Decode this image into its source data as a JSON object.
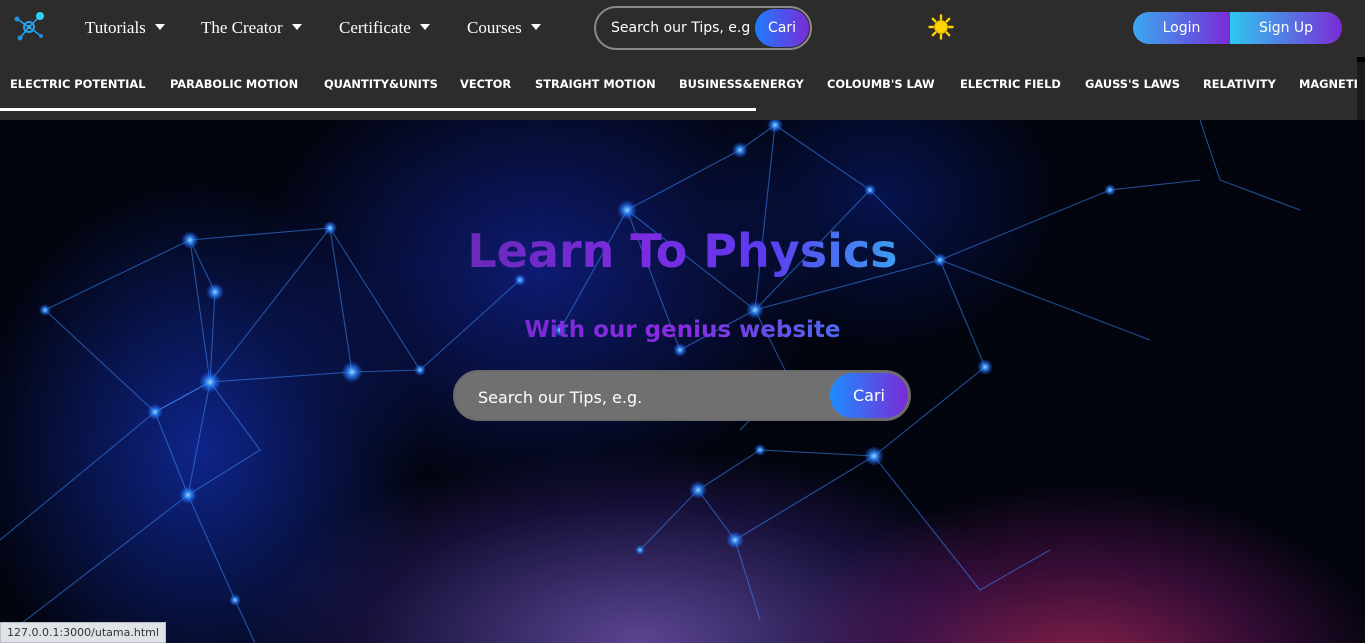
{
  "nav": {
    "items": [
      {
        "label": "Tutorials"
      },
      {
        "label": "The Creator"
      },
      {
        "label": "Certificate"
      },
      {
        "label": "Courses"
      }
    ],
    "search": {
      "placeholder": "Search our Tips, e.g.",
      "button": "Cari"
    },
    "login": "Login",
    "signup": "Sign Up"
  },
  "topics": [
    "ELECTRIC POTENTIAL",
    "PARABOLIC MOTION",
    "QUANTITY&UNITS",
    "VECTOR",
    "STRAIGHT MOTION",
    "BUSINESS&ENERGY",
    "COLOUMB'S LAW",
    "ELECTRIC FIELD",
    "GAUSS'S LAWS",
    "RELATIVITY",
    "MAGNETIC"
  ],
  "hero": {
    "title": "Learn To Physics",
    "subtitle": "With our genius website",
    "search": {
      "placeholder": "Search our Tips, e.g.",
      "button": "Cari"
    }
  },
  "status": {
    "url": "127.0.0.1:3000/utama.html"
  },
  "colors": {
    "bar": "#2e2b2b",
    "accent_blue": "#1e7cff",
    "accent_purple": "#7a2bd6",
    "sun": "#ffd400"
  },
  "icons": {
    "logo": "atom-network-logo-icon",
    "caret": "caret-down-icon",
    "theme": "sun-icon"
  }
}
